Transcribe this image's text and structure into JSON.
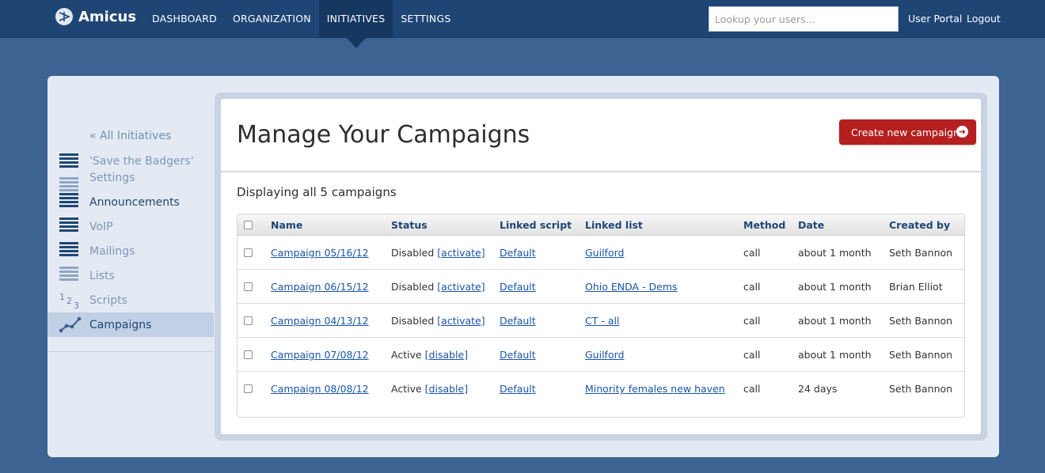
{
  "app": {
    "name": "Amicus"
  },
  "nav": {
    "items": [
      {
        "label": "DASHBOARD"
      },
      {
        "label": "ORGANIZATION"
      },
      {
        "label": "INITIATIVES"
      },
      {
        "label": "SETTINGS"
      }
    ],
    "active": "INITIATIVES"
  },
  "search": {
    "placeholder": "Lookup your users...",
    "value": ""
  },
  "header_links": {
    "user_portal": "User Portal",
    "logout": "Logout"
  },
  "sidebar": {
    "back_label": "« All Initiatives",
    "items": [
      {
        "label": "'Save the Badgers' Settings",
        "icon": "list-icon"
      },
      {
        "label": "Announcements",
        "icon": "list-icon"
      },
      {
        "label": "VoIP",
        "icon": "list-icon"
      },
      {
        "label": "Mailings",
        "icon": "list-icon"
      },
      {
        "label": "Lists",
        "icon": "list-icon"
      },
      {
        "label": "Scripts",
        "icon": "numbers-icon"
      },
      {
        "label": "Campaigns",
        "icon": "line-chart-icon"
      }
    ],
    "selected": "Campaigns"
  },
  "main": {
    "title": "Manage Your Campaigns",
    "create_button": "Create new campaign",
    "summary": "Displaying all 5 campaigns",
    "columns": [
      "Name",
      "Status",
      "Linked script",
      "Linked list",
      "Method",
      "Date",
      "Created by"
    ],
    "rows": [
      {
        "name": "Campaign 05/16/12",
        "status": "Disabled",
        "action": "[activate]",
        "script": "Default",
        "list": "Guilford",
        "method": "call",
        "date": "about 1 month",
        "created_by": "Seth Bannon"
      },
      {
        "name": "Campaign 06/15/12",
        "status": "Disabled",
        "action": "[activate]",
        "script": "Default",
        "list": "Ohio ENDA - Dems",
        "method": "call",
        "date": "about 1 month",
        "created_by": "Brian Elliot"
      },
      {
        "name": "Campaign 04/13/12",
        "status": "Disabled",
        "action": "[activate]",
        "script": "Default",
        "list": "CT - all",
        "method": "call",
        "date": "about 1 month",
        "created_by": "Seth Bannon"
      },
      {
        "name": "Campaign 07/08/12",
        "status": "Active",
        "action": "[disable]",
        "script": "Default",
        "list": "Guilford",
        "method": "call",
        "date": "about 1 month",
        "created_by": "Seth Bannon"
      },
      {
        "name": "Campaign 08/08/12",
        "status": "Active",
        "action": "[disable]",
        "script": "Default",
        "list": "Minority females new haven",
        "method": "call",
        "date": "24 days",
        "created_by": "Seth Bannon"
      }
    ]
  },
  "colors": {
    "nav_bg": "#1f4575",
    "page_bg": "#3c6391",
    "accent_red": "#b51f20",
    "link": "#1a55a8"
  }
}
